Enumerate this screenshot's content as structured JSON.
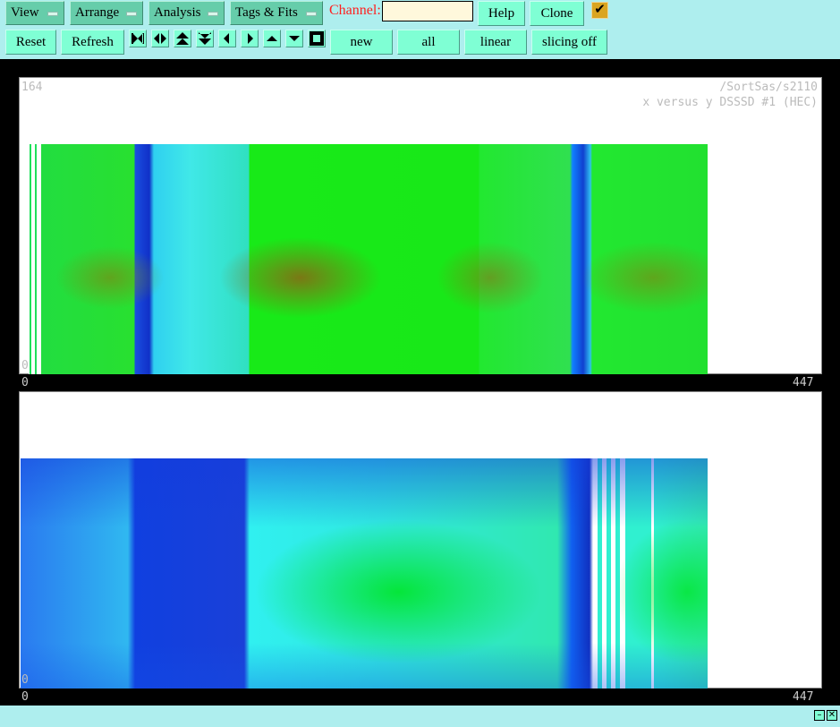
{
  "toolbar": {
    "menus": [
      "View",
      "Arrange",
      "Analysis",
      "Tags & Fits"
    ],
    "channel_label": "Channel:",
    "channel_value": "",
    "help": "Help",
    "clone": "Clone",
    "reset": "Reset",
    "refresh": "Refresh",
    "icons": [
      "expand-horizontal-icon",
      "contract-horizontal-icon",
      "expand-vertical-icon",
      "contract-vertical-icon",
      "left-icon",
      "right-icon",
      "up-icon",
      "down-icon",
      "full-view-icon"
    ],
    "new": "new",
    "all": "all",
    "scale": "linear",
    "slicing": "slicing off",
    "checkbox_checked": true
  },
  "panel1": {
    "ymax": "164",
    "ymin": "0",
    "path": "/SortSas/s2110",
    "title": "x versus y DSSSD #1 (HEC)",
    "xmin": "0",
    "xmax": "447"
  },
  "panel2": {
    "ymin": "0",
    "xmin": "0",
    "xmax": "447"
  },
  "bottom": {
    "minimize": "–",
    "close": "✕"
  }
}
